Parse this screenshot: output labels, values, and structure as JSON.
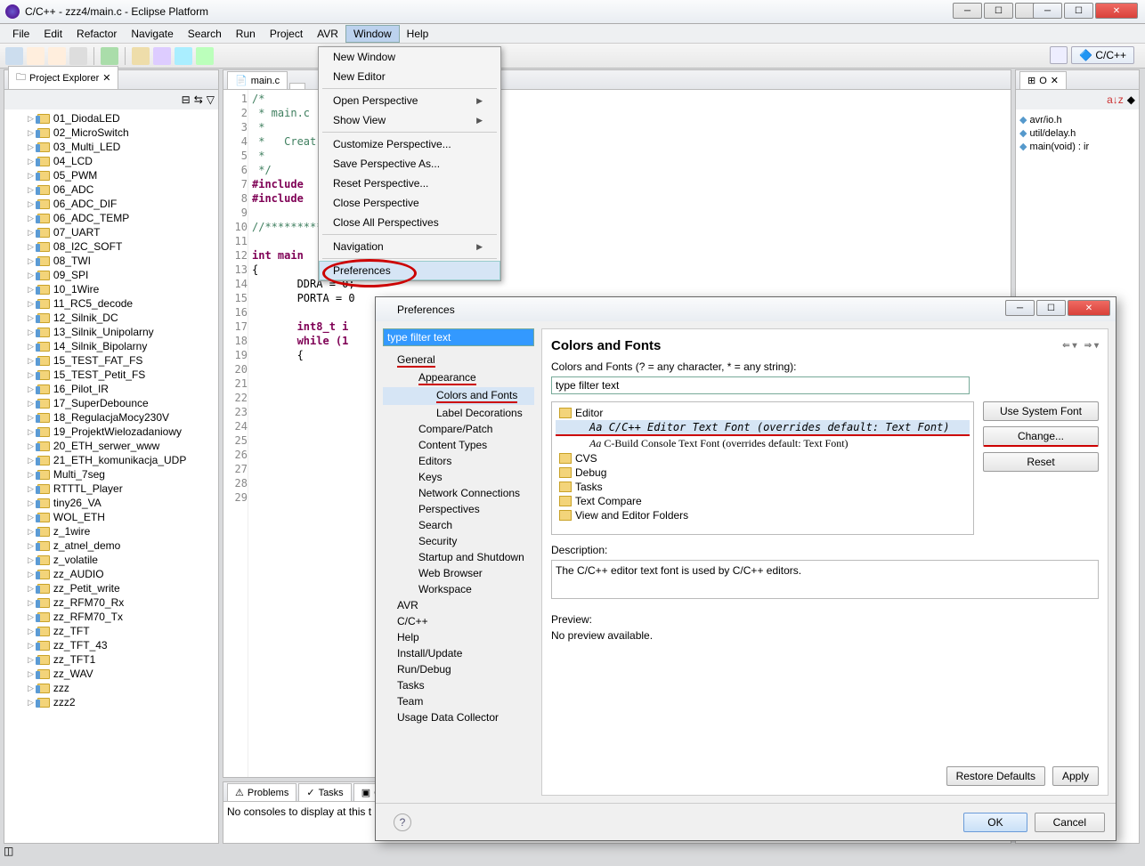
{
  "title": "C/C++ - zzz4/main.c - Eclipse Platform",
  "menu": [
    "File",
    "Edit",
    "Refactor",
    "Navigate",
    "Search",
    "Run",
    "Project",
    "AVR",
    "Window",
    "Help"
  ],
  "active_menu_index": 8,
  "perspective_label": "C/C++",
  "project_explorer": {
    "title": "Project Explorer",
    "items": [
      "01_DiodaLED",
      "02_MicroSwitch",
      "03_Multi_LED",
      "04_LCD",
      "05_PWM",
      "06_ADC",
      "06_ADC_DIF",
      "06_ADC_TEMP",
      "07_UART",
      "08_I2C_SOFT",
      "08_TWI",
      "09_SPI",
      "10_1Wire",
      "11_RC5_decode",
      "12_Silnik_DC",
      "13_Silnik_Unipolarny",
      "14_Silnik_Bipolarny",
      "15_TEST_FAT_FS",
      "15_TEST_Petit_FS",
      "16_Pilot_IR",
      "17_SuperDebounce",
      "18_RegulacjaMocy230V",
      "19_ProjektWielozadaniowy",
      "20_ETH_serwer_www",
      "21_ETH_komunikacja_UDP",
      "Multi_7seg",
      "RTTTL_Player",
      "tiny26_VA",
      "WOL_ETH",
      "z_1wire",
      "z_atnel_demo",
      "z_volatile",
      "zz_AUDIO",
      "zz_Petit_write",
      "zz_RFM70_Rx",
      "zz_RFM70_Tx",
      "zz_TFT",
      "zz_TFT_43",
      "zz_TFT1",
      "zz_WAV",
      "zzz",
      "zzz2"
    ]
  },
  "editor_tab": "main.c",
  "code_lines": [
    "/*",
    " * main.c",
    " *",
    " *   Creat",
    " *",
    " */",
    "#include",
    "#include",
    "",
    "//*************mu*****",
    "",
    "int main",
    "{",
    "       DDRA = 0;",
    "       PORTA = 0",
    "",
    "       int8_t i",
    "       while (1",
    "       {",
    "",
    "",
    "",
    "",
    "",
    "",
    "",
    "",
    "",
    ""
  ],
  "problems_tab": "Problems",
  "tasks_tab": "Tasks",
  "console_tab": "C",
  "console_empty": "No consoles to display at this t",
  "outline": {
    "tab": "O",
    "items": [
      "avr/io.h",
      "util/delay.h",
      "main(void) : ir"
    ]
  },
  "dropdown": [
    {
      "label": "New Window"
    },
    {
      "label": "New Editor"
    },
    {
      "sep": true
    },
    {
      "label": "Open Perspective",
      "sub": true
    },
    {
      "label": "Show View",
      "sub": true
    },
    {
      "sep": true
    },
    {
      "label": "Customize Perspective..."
    },
    {
      "label": "Save Perspective As..."
    },
    {
      "label": "Reset Perspective..."
    },
    {
      "label": "Close Perspective"
    },
    {
      "label": "Close All Perspectives"
    },
    {
      "sep": true
    },
    {
      "label": "Navigation",
      "sub": true
    },
    {
      "sep": true
    },
    {
      "label": "Preferences",
      "hover": true,
      "circled": true
    }
  ],
  "pref": {
    "title": "Preferences",
    "filter_placeholder": "type filter text",
    "tree": {
      "general": "General",
      "appearance": "Appearance",
      "colors_fonts": "Colors and Fonts",
      "label_dec": "Label Decorations",
      "compare": "Compare/Patch",
      "content_types": "Content Types",
      "editors": "Editors",
      "keys": "Keys",
      "network": "Network Connections",
      "perspectives": "Perspectives",
      "search": "Search",
      "security": "Security",
      "startup": "Startup and Shutdown",
      "web": "Web Browser",
      "workspace": "Workspace",
      "avr": "AVR",
      "ccpp": "C/C++",
      "help": "Help",
      "install": "Install/Update",
      "rundebug": "Run/Debug",
      "tasks": "Tasks",
      "team": "Team",
      "usage": "Usage Data Collector"
    },
    "page_title": "Colors and Fonts",
    "hint": "Colors and Fonts (? = any character, * = any string):",
    "filter2": "type filter text",
    "folders": {
      "editor": "Editor",
      "ccfont": "C/C++ Editor Text Font (overrides default: Text Font)",
      "cbuild": "C-Build Console Text Font (overrides default: Text Font)",
      "cvs": "CVS",
      "debug": "Debug",
      "tasks": "Tasks",
      "textcmp": "Text Compare",
      "view": "View and Editor Folders"
    },
    "btn_system": "Use System Font",
    "btn_change": "Change...",
    "btn_reset": "Reset",
    "desc_label": "Description:",
    "desc_text": "The C/C++ editor text font is used by C/C++ editors.",
    "preview_label": "Preview:",
    "preview_text": "No preview available.",
    "restore": "Restore Defaults",
    "apply": "Apply",
    "ok": "OK",
    "cancel": "Cancel"
  }
}
